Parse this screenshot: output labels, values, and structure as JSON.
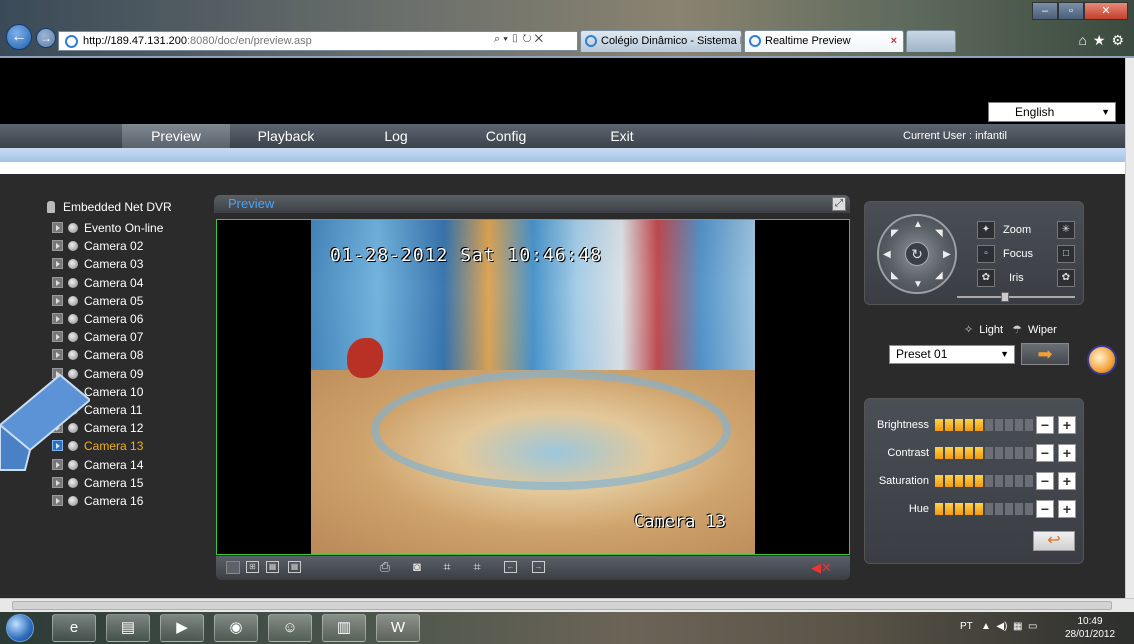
{
  "browser": {
    "address_host": "http://189.47.131.200",
    "address_path": ":8080/doc/en/preview.asp",
    "tabs": [
      {
        "label": "Colégio Dinâmico - Sistema ET..."
      },
      {
        "label": "Realtime Preview"
      }
    ]
  },
  "language": {
    "selected": "English"
  },
  "menu": {
    "items": [
      "Preview",
      "Playback",
      "Log",
      "Config",
      "Exit"
    ],
    "active": "Preview",
    "current_user": "Current User : infantil"
  },
  "tree": {
    "root": "Embedded Net DVR",
    "items": [
      "Evento On-line",
      "Camera 02",
      "Camera 03",
      "Camera 04",
      "Camera 05",
      "Camera 06",
      "Camera 07",
      "Camera 08",
      "Camera 09",
      "Camera 10",
      "Camera 11",
      "Camera 12",
      "Camera 13",
      "Camera 14",
      "Camera 15",
      "Camera 16"
    ],
    "selected": "Camera 13"
  },
  "preview": {
    "title": "Preview",
    "osd_datetime": "01-28-2012 Sat 10:46:48",
    "osd_camera": "Camera 13"
  },
  "ptz": {
    "zoom_label": "Zoom",
    "focus_label": "Focus",
    "iris_label": "Iris",
    "light_label": "Light",
    "wiper_label": "Wiper",
    "preset_selected": "Preset 01"
  },
  "image_settings": [
    {
      "label": "Brightness",
      "level": 5,
      "max": 10
    },
    {
      "label": "Contrast",
      "level": 5,
      "max": 10
    },
    {
      "label": "Saturation",
      "level": 5,
      "max": 10
    },
    {
      "label": "Hue",
      "level": 5,
      "max": 10
    }
  ],
  "taskbar": {
    "tray_lang": "PT",
    "time": "10:49",
    "date": "28/01/2012"
  },
  "colors": {
    "accent_blue": "#4ea2f0",
    "selected_orange": "#f0b020",
    "video_border": "#3cc43c"
  }
}
